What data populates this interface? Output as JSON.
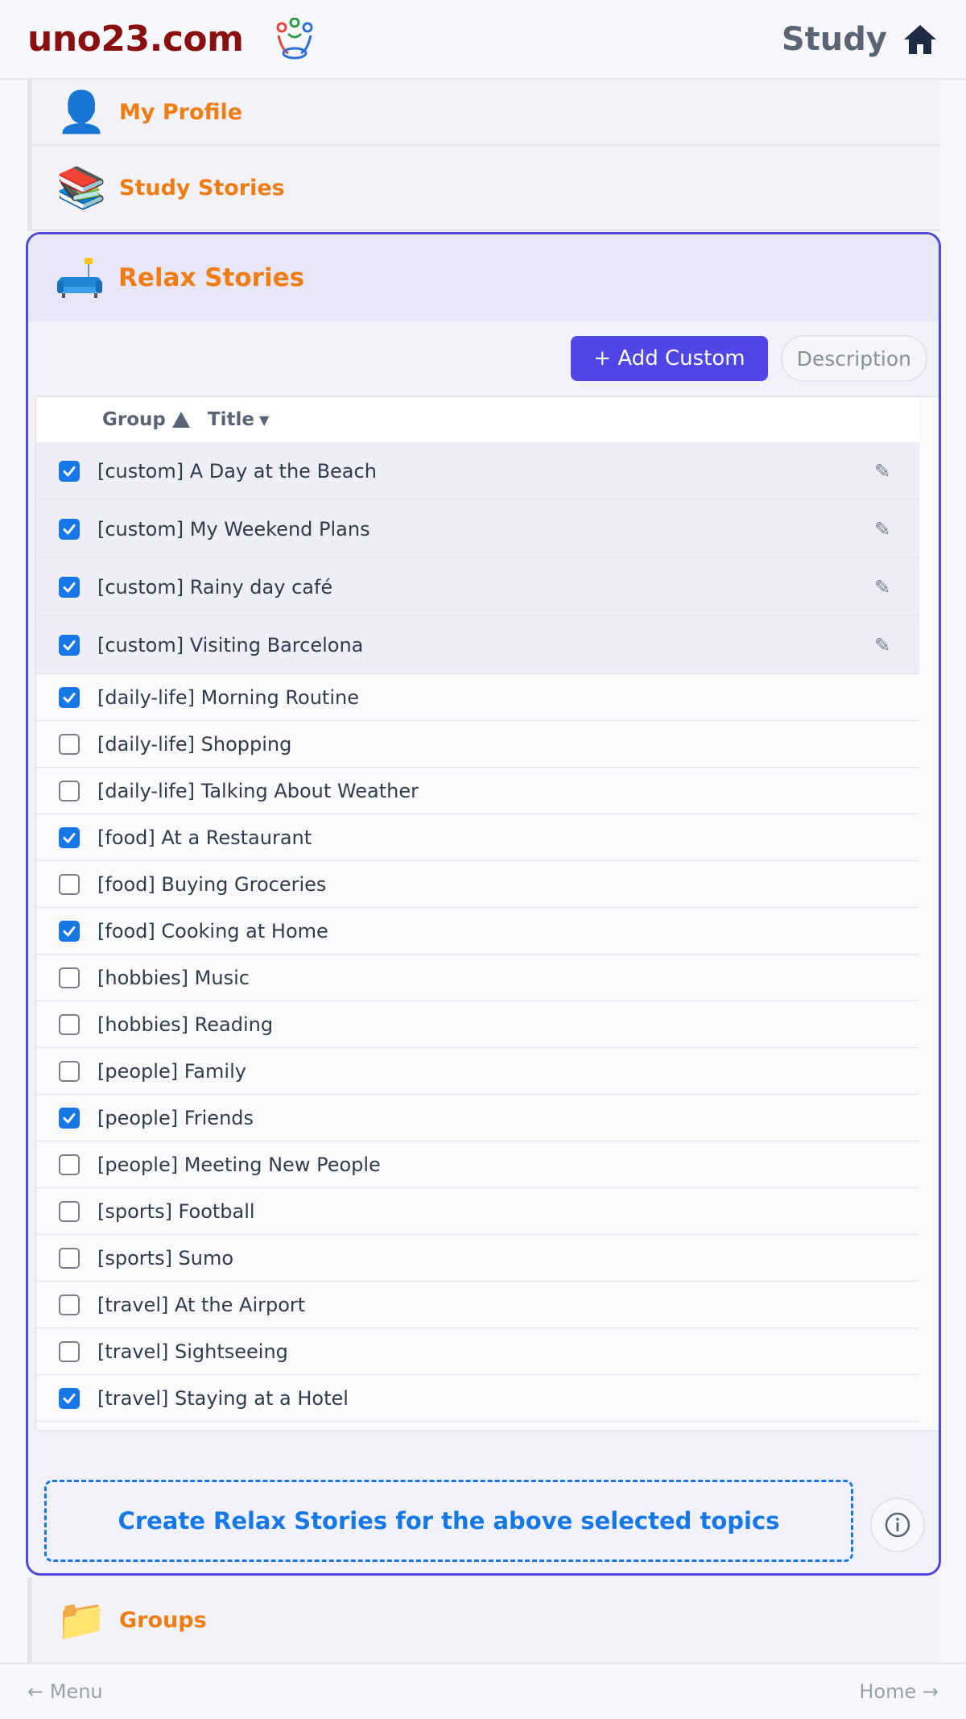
{
  "header": {
    "logo": "uno23.com",
    "study_label": "Study",
    "icons": {
      "logo_mark": "people-circle-logo-icon",
      "home": "home-icon"
    }
  },
  "sidebar": {
    "profile": {
      "label": "My Profile",
      "icon": "👤"
    },
    "study_stories": {
      "label": "Study Stories",
      "icon": "📚"
    },
    "relax_stories": {
      "label": "Relax Stories",
      "icon": "sofa-lamp-icon"
    },
    "groups": {
      "label": "Groups",
      "icon": "📁"
    }
  },
  "toolbar": {
    "add_custom": "+ Add Custom",
    "description": "Description"
  },
  "list": {
    "col_group": "Group",
    "col_title": "Title",
    "items": [
      {
        "label": "[custom] A Day at the Beach",
        "checked": true,
        "custom": true
      },
      {
        "label": "[custom] My Weekend Plans",
        "checked": true,
        "custom": true
      },
      {
        "label": "[custom] Rainy day café",
        "checked": true,
        "custom": true
      },
      {
        "label": "[custom] Visiting Barcelona",
        "checked": true,
        "custom": true
      },
      {
        "label": "[daily-life] Morning Routine",
        "checked": true,
        "custom": false
      },
      {
        "label": "[daily-life] Shopping",
        "checked": false,
        "custom": false
      },
      {
        "label": "[daily-life] Talking About Weather",
        "checked": false,
        "custom": false
      },
      {
        "label": "[food] At a Restaurant",
        "checked": true,
        "custom": false
      },
      {
        "label": "[food] Buying Groceries",
        "checked": false,
        "custom": false
      },
      {
        "label": "[food] Cooking at Home",
        "checked": true,
        "custom": false
      },
      {
        "label": "[hobbies] Music",
        "checked": false,
        "custom": false
      },
      {
        "label": "[hobbies] Reading",
        "checked": false,
        "custom": false
      },
      {
        "label": "[people] Family",
        "checked": false,
        "custom": false
      },
      {
        "label": "[people] Friends",
        "checked": true,
        "custom": false
      },
      {
        "label": "[people] Meeting New People",
        "checked": false,
        "custom": false
      },
      {
        "label": "[sports] Football",
        "checked": false,
        "custom": false
      },
      {
        "label": "[sports] Sumo",
        "checked": false,
        "custom": false
      },
      {
        "label": "[travel] At the Airport",
        "checked": false,
        "custom": false
      },
      {
        "label": "[travel] Sightseeing",
        "checked": false,
        "custom": false
      },
      {
        "label": "[travel] Staying at a Hotel",
        "checked": true,
        "custom": false
      }
    ]
  },
  "create_button": "Create Relax Stories for the above selected topics",
  "footer": {
    "menu": "← Menu",
    "home": "Home →"
  },
  "colors": {
    "accent": "#5046e5",
    "link_blue": "#1677e6",
    "section_orange": "#f07c14",
    "logo_red": "#8a1010"
  }
}
